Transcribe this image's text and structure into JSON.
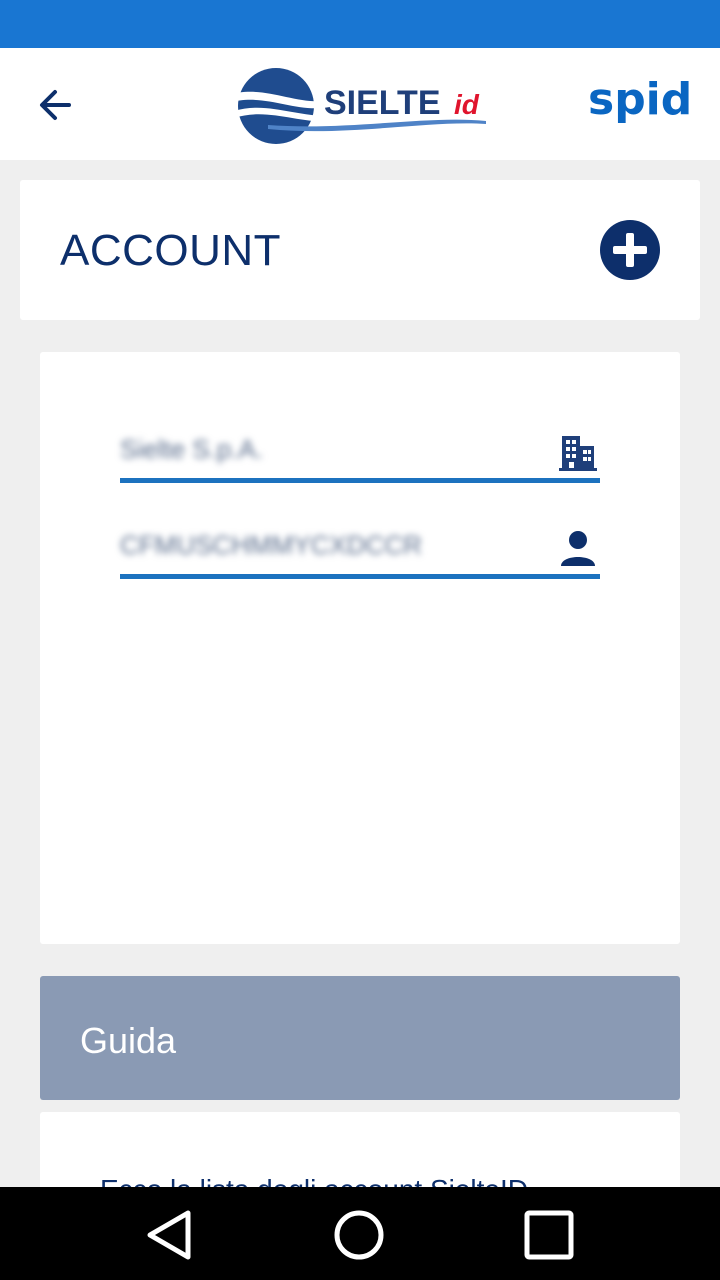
{
  "header": {
    "back_icon": "arrow-left-icon",
    "logo_text": "SIELTE",
    "logo_suffix": "id",
    "spid_logo_text": "spid"
  },
  "account_section": {
    "title": "ACCOUNT",
    "add_icon": "plus-circle-icon"
  },
  "accounts": [
    {
      "organization": "Sielte S.p.A.",
      "organization_icon": "building-icon",
      "user_id": "CFMUSCHMMYCXDCCR",
      "user_icon": "person-icon"
    }
  ],
  "guide": {
    "title": "Guida",
    "text": "Ecco la lista degli account SielteID"
  },
  "nav": {
    "back_icon": "nav-back-icon",
    "home_icon": "nav-home-icon",
    "recent_icon": "nav-recent-icon"
  },
  "colors": {
    "status_bar": "#1976d2",
    "primary_dark": "#0d2f6b",
    "field_underline": "#1c72bf",
    "guide_header": "#8a9ab4",
    "logo_red": "#e0142d",
    "spid_blue": "#0a66c2"
  }
}
